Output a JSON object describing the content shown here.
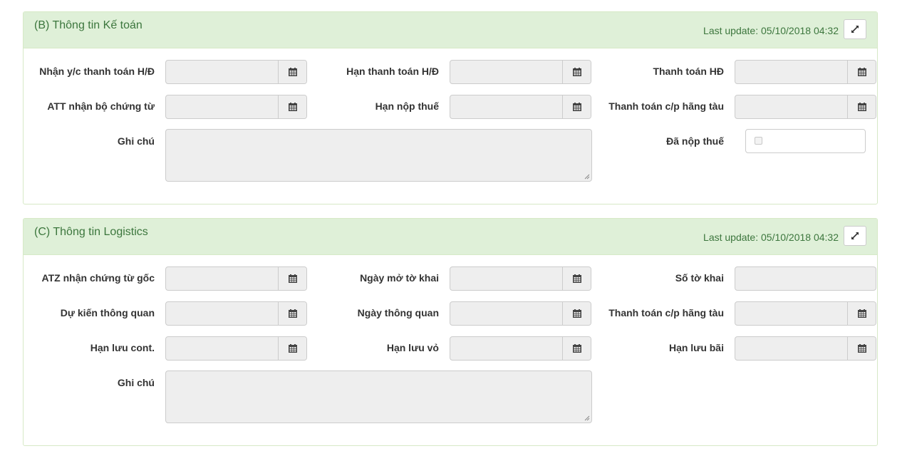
{
  "panel_b": {
    "title": "(B) Thông tin Kế toán",
    "last_update": "Last update: 05/10/2018 04:32",
    "fields": {
      "nhan_yc": "Nhận y/c thanh toán H/Đ",
      "han_thanh_toan": "Hạn thanh toán H/Đ",
      "thanh_toan_hd": "Thanh toán HĐ",
      "att_nhan": "ATT nhận bộ chứng từ",
      "han_nop_thue": "Hạn nộp thuế",
      "thanh_toan_cp": "Thanh toán c/p hãng tàu",
      "ghi_chu": "Ghi chú",
      "da_nop_thue": "Đã nộp thuế"
    }
  },
  "panel_c": {
    "title": "(C) Thông tin Logistics",
    "last_update": "Last update: 05/10/2018 04:32",
    "fields": {
      "atz_nhan": "ATZ nhận chứng từ gốc",
      "ngay_mo_to_khai": "Ngày mở tờ khai",
      "so_to_khai": "Số tờ khai",
      "du_kien_thong_quan": "Dự kiến thông quan",
      "ngay_thong_quan": "Ngày thông quan",
      "thanh_toan_cp": "Thanh toán c/p hãng tàu",
      "han_luu_cont": "Hạn lưu cont.",
      "han_luu_vo": "Hạn lưu vỏ",
      "han_luu_bai": "Hạn lưu bãi",
      "ghi_chu": "Ghi chú"
    }
  },
  "colors": {
    "heading_bg": "#dff0d8",
    "heading_text": "#3c763d",
    "panel_border": "#d6e9c6",
    "readonly_bg": "#eeeeee"
  },
  "icons": [
    "calendar-icon",
    "expand-icon"
  ]
}
